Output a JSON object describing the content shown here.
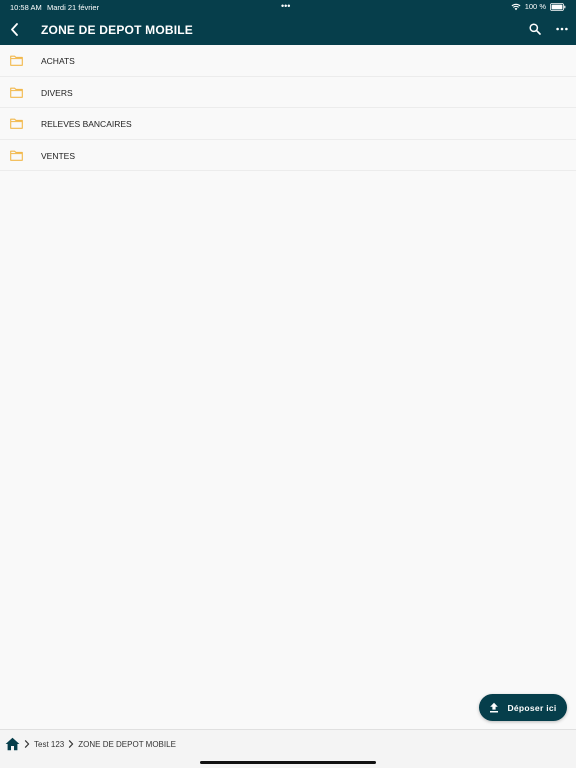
{
  "status_bar": {
    "time": "10:58 AM",
    "date": "Mardi 21 février",
    "multitask_dots": "•••",
    "battery": "100 %"
  },
  "header": {
    "title": "ZONE DE DEPOT MOBILE",
    "back_icon": "chevron-left-icon",
    "search_icon": "search-icon",
    "more_icon": "more-horizontal-icon"
  },
  "folders": [
    {
      "label": "ACHATS"
    },
    {
      "label": "DIVERS"
    },
    {
      "label": "RELEVES BANCAIRES"
    },
    {
      "label": "VENTES"
    }
  ],
  "upload_button": {
    "label": "Déposer ici",
    "icon": "upload-icon"
  },
  "breadcrumb": {
    "home_icon": "home-icon",
    "items": [
      "Test 123",
      "ZONE DE DEPOT MOBILE"
    ]
  },
  "colors": {
    "primary": "#063e4b",
    "folder": "#f2b84b",
    "background": "#f9f9f9"
  }
}
